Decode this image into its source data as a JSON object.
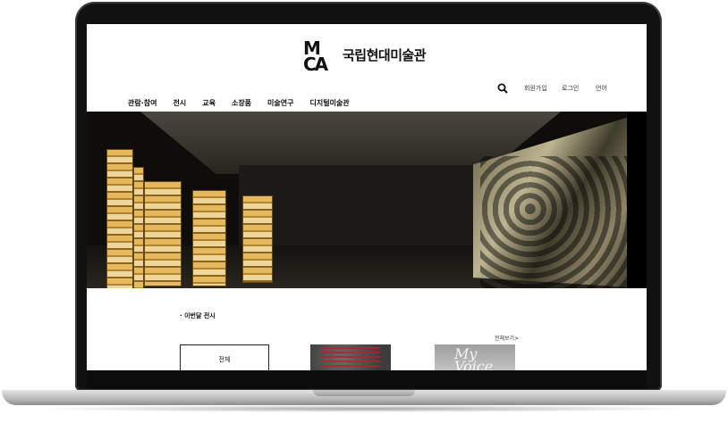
{
  "site": {
    "logo_mark_top": "M",
    "logo_mark_bottom": "CA",
    "logo_text": "국립현대미술관"
  },
  "utility": {
    "search_icon": "search-icon",
    "join": "회원가입",
    "login": "로그인",
    "language": "언어"
  },
  "nav": {
    "items": [
      "관람·참여",
      "전시",
      "교육",
      "소장품",
      "미술연구",
      "디지털미술관"
    ]
  },
  "section": {
    "title": "· 이번달 전시",
    "more": "전체보기>",
    "tab_all": "전체",
    "thumb2_text": "My Voice"
  },
  "colors": {
    "frame": "#111111",
    "text": "#111111"
  }
}
